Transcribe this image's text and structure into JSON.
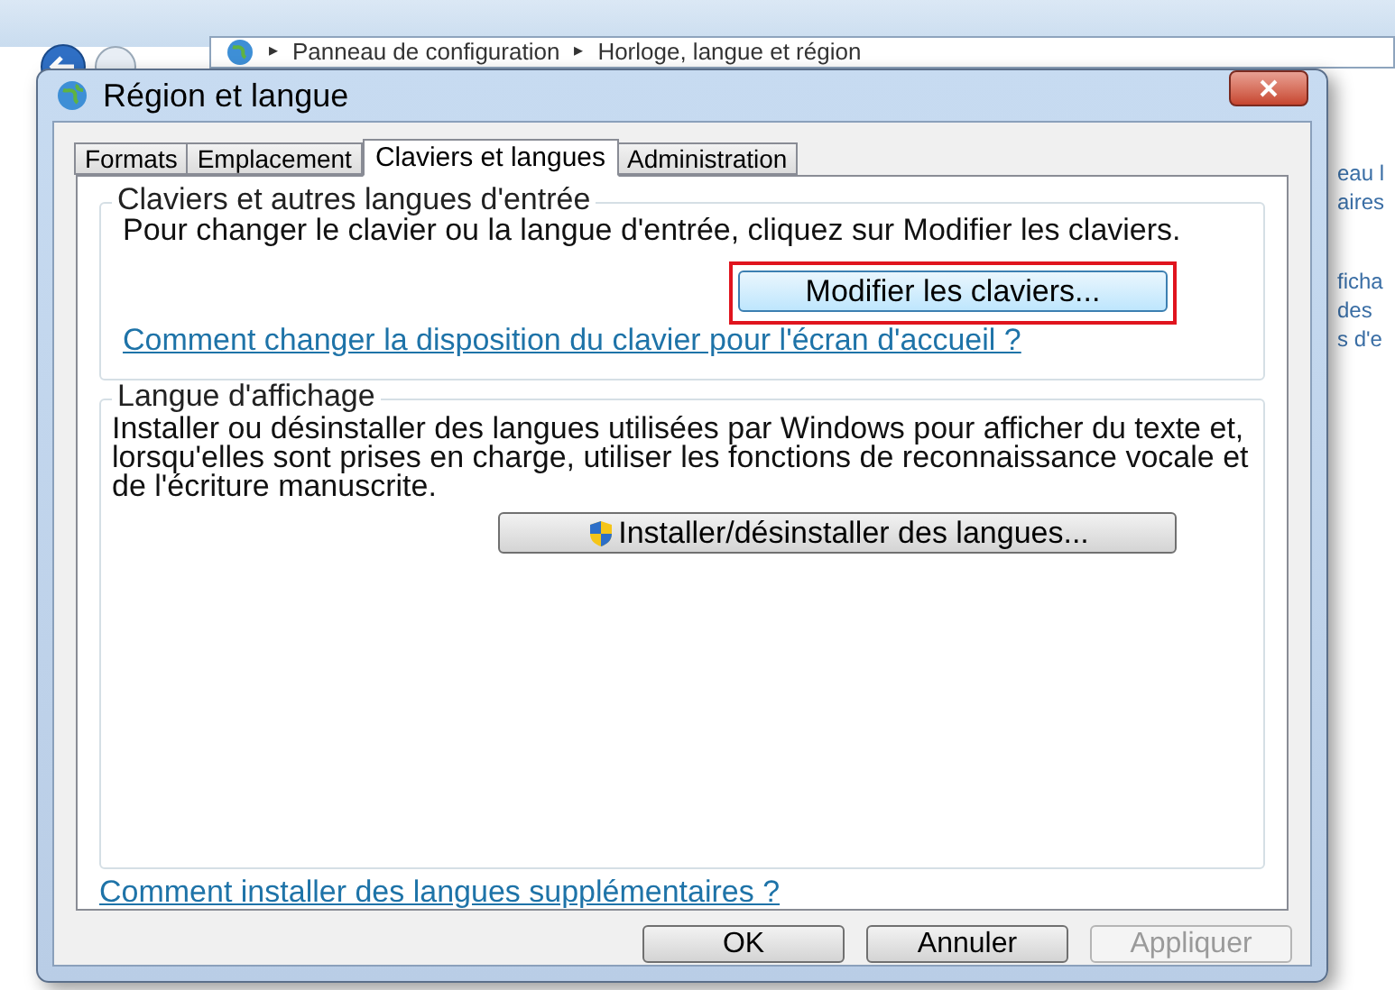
{
  "explorer": {
    "separator": "▸",
    "breadcrumb": [
      "Panneau de configuration",
      "Horloge, langue et région"
    ],
    "side_fragments": [
      "eau l",
      "aires",
      "ficha",
      "des",
      "s d'e"
    ]
  },
  "window": {
    "title": "Région et langue"
  },
  "tabs": [
    {
      "label": "Formats",
      "selected": false
    },
    {
      "label": "Emplacement",
      "selected": false
    },
    {
      "label": "Claviers et langues",
      "selected": true
    },
    {
      "label": "Administration",
      "selected": false
    }
  ],
  "keyboard_group": {
    "title": "Claviers et autres langues d'entrée",
    "text": "Pour changer le clavier ou la langue d'entrée, cliquez sur Modifier les claviers.",
    "button": {
      "label": "Modifier les claviers...",
      "highlighted": true
    },
    "link": "Comment changer la disposition du clavier pour l'écran d'accueil ?"
  },
  "display_group": {
    "title": "Langue d'affichage",
    "text": "Installer ou désinstaller des langues utilisées par Windows pour afficher du texte et, lorsqu'elles sont prises en charge, utiliser les fonctions de reconnaissance vocale et de l'écriture manuscrite.",
    "button": {
      "label": "Installer/désinstaller des langues..."
    }
  },
  "bottom_link": "Comment installer des langues supplémentaires ?",
  "buttons": [
    {
      "label": "OK",
      "disabled": false
    },
    {
      "label": "Annuler",
      "disabled": false
    },
    {
      "label": "Appliquer",
      "disabled": true
    }
  ]
}
